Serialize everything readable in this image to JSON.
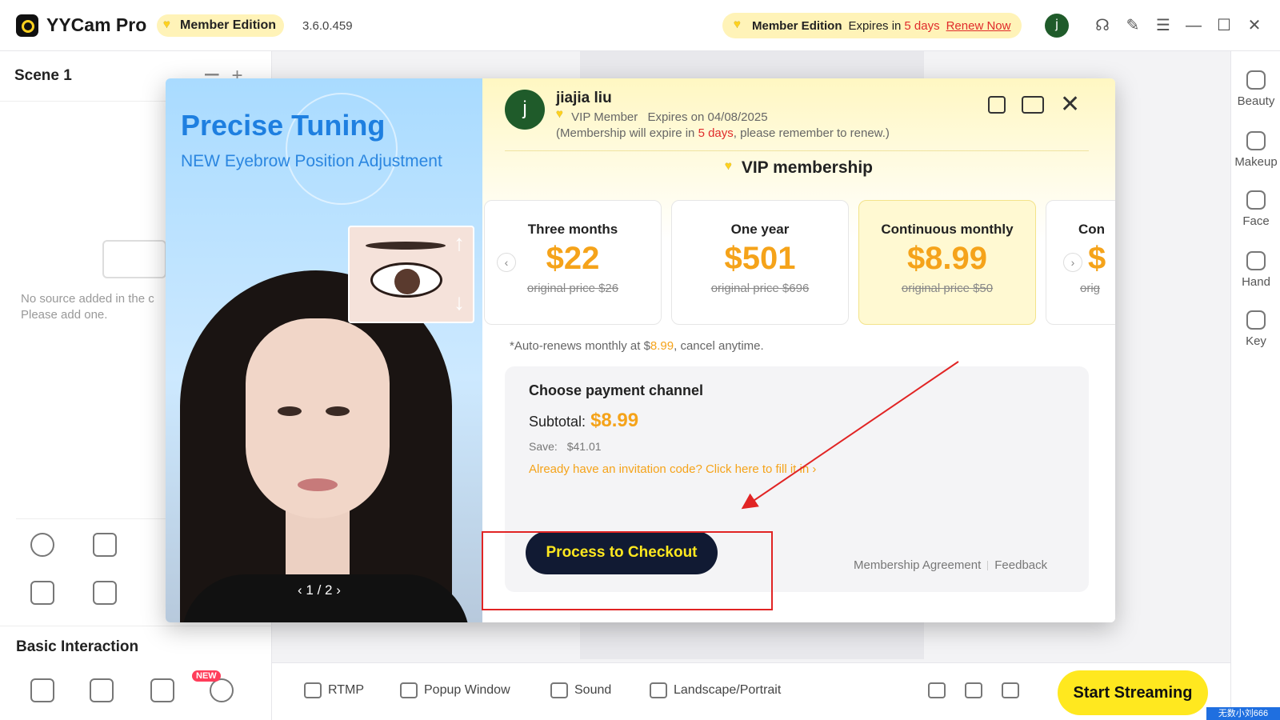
{
  "titlebar": {
    "app_name": "YYCam Pro",
    "member_badge": "Member Edition",
    "version": "3.6.0.459",
    "expire_member": "Member Edition",
    "expire_prefix": "Expires in",
    "expire_days": "5 days",
    "renew_label": "Renew Now",
    "avatar_letter": "j",
    "icons": [
      "headset-icon",
      "notes-icon",
      "menu-icon",
      "minimize-icon",
      "maximize-icon",
      "close-icon"
    ]
  },
  "left": {
    "scene_title": "Scene 1",
    "empty_text_1": "No source added in the c",
    "empty_text_2": "Please add one.",
    "basic_title": "Basic Interaction",
    "new_badge": "NEW"
  },
  "right_sidebar": {
    "items": [
      {
        "label": "Beauty",
        "icon": "beauty-icon"
      },
      {
        "label": "Makeup",
        "icon": "makeup-icon"
      },
      {
        "label": "Face",
        "icon": "face-icon"
      },
      {
        "label": "Hand",
        "icon": "hand-icon"
      },
      {
        "label": "Key",
        "icon": "key-icon"
      }
    ]
  },
  "bottombar": {
    "items": [
      {
        "label": "RTMP",
        "icon": "rtmp-icon"
      },
      {
        "label": "Popup Window",
        "icon": "popup-window-icon"
      },
      {
        "label": "Sound",
        "icon": "sound-icon"
      },
      {
        "label": "Landscape/Portrait",
        "icon": "orientation-icon"
      }
    ],
    "start_label": "Start Streaming",
    "watermark": "无数小刘666"
  },
  "promo": {
    "title": "Precise Tuning",
    "subtitle": "NEW Eyebrow Position Adjustment",
    "pager": "1 / 2"
  },
  "payment": {
    "user_name": "jiajia liu",
    "avatar_letter": "j",
    "vip_status": "VIP Member",
    "expires_on": "Expires on 04/08/2025",
    "notice_prefix": "(Membership will expire in",
    "notice_days": "5 days",
    "notice_suffix": ", please remember to renew.)",
    "vip_title": "VIP membership",
    "plans": [
      {
        "name": "Three months",
        "price": "$22",
        "orig": "original price $26"
      },
      {
        "name": "One year",
        "price": "$501",
        "orig": "original price $696"
      },
      {
        "name": "Continuous monthly",
        "price": "$8.99",
        "orig": "original price $50"
      },
      {
        "name": "Con",
        "price": "$",
        "orig": "orig"
      }
    ],
    "selected_plan": 2,
    "autorenew_prefix": "*Auto-renews monthly at $",
    "autorenew_amount": "8.99",
    "autorenew_suffix": ", cancel anytime.",
    "channel_title": "Choose payment channel",
    "subtotal_label": "Subtotal:",
    "subtotal_amount": "$8.99",
    "save_label": "Save:",
    "save_amount": "$41.01",
    "invite_text": "Already have an invitation code? Click here to fill it in ›",
    "checkout_label": "Process to Checkout",
    "agreement_label": "Membership Agreement",
    "feedback_label": "Feedback"
  },
  "colors": {
    "accent_yellow": "#ffe81f",
    "price_orange": "#f5a31a",
    "alert_red": "#e02b2b",
    "dark_button": "#111a33",
    "promo_blue": "#1e7fe0"
  }
}
